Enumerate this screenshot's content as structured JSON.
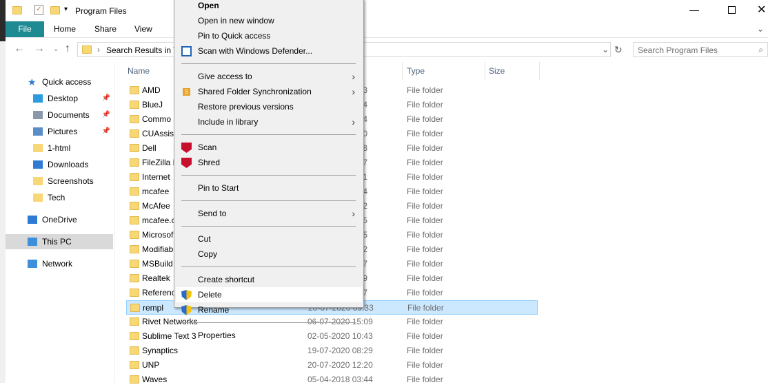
{
  "window": {
    "title": "Program Files",
    "controls": [
      "minimize",
      "maximize",
      "close"
    ]
  },
  "ribbon": {
    "tabs": [
      "File",
      "Home",
      "Share",
      "View"
    ]
  },
  "address": {
    "path": "Search Results in T",
    "search_placeholder": "Search Program Files"
  },
  "sidebar": {
    "items": [
      {
        "label": "Quick access",
        "icon": "star-icon"
      },
      {
        "label": "Desktop",
        "icon": "desktop-icon",
        "pinned": true
      },
      {
        "label": "Documents",
        "icon": "documents-icon",
        "pinned": true
      },
      {
        "label": "Pictures",
        "icon": "pictures-icon",
        "pinned": true
      },
      {
        "label": "1-html",
        "icon": "folder-icon"
      },
      {
        "label": "Downloads",
        "icon": "download-icon"
      },
      {
        "label": "Screenshots",
        "icon": "folder-icon"
      },
      {
        "label": "Tech",
        "icon": "folder-icon"
      },
      {
        "label": "OneDrive",
        "icon": "cloud-icon"
      },
      {
        "label": "This PC",
        "icon": "computer-icon",
        "selected": true
      },
      {
        "label": "Network",
        "icon": "network-icon"
      }
    ]
  },
  "columns": {
    "name": "Name",
    "type": "Type",
    "size": "Size"
  },
  "files": [
    {
      "name": "AMD",
      "date": "3",
      "type": "File folder"
    },
    {
      "name": "BlueJ",
      "date": "4",
      "type": "File folder"
    },
    {
      "name": "Commo",
      "date": "4",
      "type": "File folder"
    },
    {
      "name": "CUAssist",
      "date": "0",
      "type": "File folder"
    },
    {
      "name": "Dell",
      "date": "8",
      "type": "File folder"
    },
    {
      "name": "FileZilla F",
      "date": "7",
      "type": "File folder"
    },
    {
      "name": "Internet",
      "date": "1",
      "type": "File folder"
    },
    {
      "name": "mcafee",
      "date": "4",
      "type": "File folder"
    },
    {
      "name": "McAfee",
      "date": "2",
      "type": "File folder"
    },
    {
      "name": "mcafee.c",
      "date": "5",
      "type": "File folder"
    },
    {
      "name": "Microsof",
      "date": "5",
      "type": "File folder"
    },
    {
      "name": "Modifiab",
      "date": "2",
      "type": "File folder"
    },
    {
      "name": "MSBuild",
      "date": "7",
      "type": "File folder"
    },
    {
      "name": "Realtek",
      "date": "9",
      "type": "File folder"
    },
    {
      "name": "Referenc",
      "date": "7",
      "type": "File folder"
    },
    {
      "name": "rempl",
      "date": "20-07-2020 09:33",
      "type": "File folder",
      "selected": true
    },
    {
      "name": "Rivet Networks",
      "date": "06-07-2020 15:09",
      "type": "File folder"
    },
    {
      "name": "Sublime Text 3",
      "date": "02-05-2020 10:43",
      "type": "File folder"
    },
    {
      "name": "Synaptics",
      "date": "19-07-2020 08:29",
      "type": "File folder"
    },
    {
      "name": "UNP",
      "date": "20-07-2020 12:20",
      "type": "File folder"
    },
    {
      "name": "Waves",
      "date": "05-04-2018 03:44",
      "type": "File folder"
    }
  ],
  "context_menu": {
    "hovered": "Delete",
    "groups": [
      [
        {
          "label": "Open",
          "bold": true
        },
        {
          "label": "Open in new window"
        },
        {
          "label": "Pin to Quick access"
        },
        {
          "label": "Scan with Windows Defender...",
          "icon": "defender-icon"
        }
      ],
      [
        {
          "label": "Give access to",
          "submenu": true
        },
        {
          "label": "Shared Folder Synchronization",
          "icon": "sync-icon",
          "submenu": true
        },
        {
          "label": "Restore previous versions"
        },
        {
          "label": "Include in library",
          "submenu": true
        }
      ],
      [
        {
          "label": "Scan",
          "icon": "mcafee-icon"
        },
        {
          "label": "Shred",
          "icon": "mcafee-icon"
        }
      ],
      [
        {
          "label": "Pin to Start"
        }
      ],
      [
        {
          "label": "Send to",
          "submenu": true
        }
      ],
      [
        {
          "label": "Cut"
        },
        {
          "label": "Copy"
        }
      ],
      [
        {
          "label": "Create shortcut"
        },
        {
          "label": "Delete",
          "icon": "shield-icon"
        },
        {
          "label": "Rename",
          "icon": "shield-icon"
        }
      ],
      [
        {
          "label": "Properties"
        }
      ]
    ]
  },
  "colors": {
    "file_tab": "#1e8a91",
    "selection": "#cce8ff",
    "menu_bg": "#f0f0f0"
  }
}
